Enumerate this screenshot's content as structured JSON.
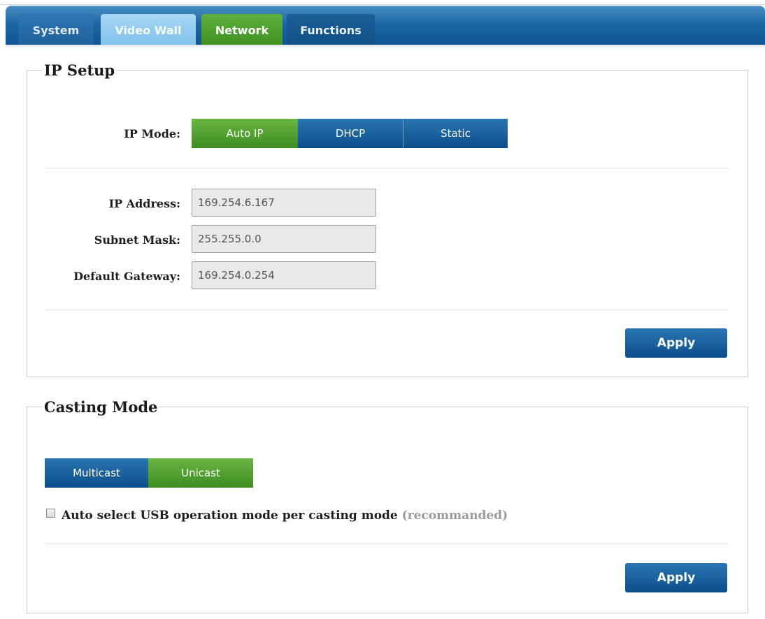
{
  "tabs": [
    {
      "label": "System"
    },
    {
      "label": "Video Wall"
    },
    {
      "label": "Network"
    },
    {
      "label": "Functions"
    }
  ],
  "active_tab": "Network",
  "ip_setup": {
    "legend": "IP Setup",
    "mode_label": "IP Mode:",
    "modes": [
      "Auto IP",
      "DHCP",
      "Static"
    ],
    "selected_mode": "Auto IP",
    "ip_address_label": "IP Address:",
    "ip_address_value": "169.254.6.167",
    "subnet_mask_label": "Subnet Mask:",
    "subnet_mask_value": "255.255.0.0",
    "gateway_label": "Default Gateway:",
    "gateway_value": "169.254.0.254",
    "apply_label": "Apply"
  },
  "casting_mode": {
    "legend": "Casting Mode",
    "modes": [
      "Multicast",
      "Unicast"
    ],
    "selected_mode": "Unicast",
    "auto_usb_label": "Auto select USB operation mode per casting mode",
    "auto_usb_note": "(recommanded)",
    "auto_usb_checked": false,
    "apply_label": "Apply"
  },
  "colors": {
    "selected": "#4f9f2f",
    "unselected": "#135a96",
    "tabbar": "#1d67a4"
  }
}
